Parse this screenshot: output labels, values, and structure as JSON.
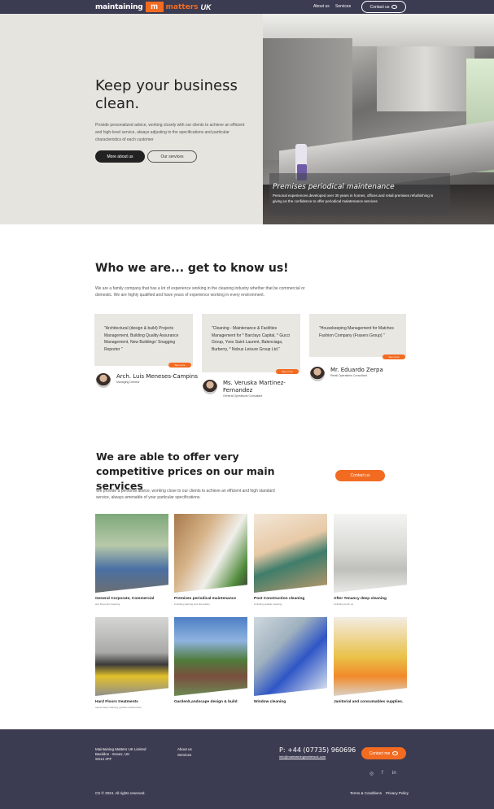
{
  "header": {
    "logo": {
      "word1": "maintaining",
      "monogram": "m",
      "word2": "matters",
      "suffix": "UK"
    },
    "nav": [
      "About us",
      "Services"
    ],
    "contact_label": "Contact us"
  },
  "hero": {
    "title": "Keep your business clean.",
    "text": "Provide personalized advice, working closely with our clients to achieve an efficient and high-level service, always adjusting to the specifications and particular characteristics of each customer",
    "btn_primary": "More about us",
    "btn_secondary": "Our services",
    "caption_title": "Premises periodical maintenance",
    "caption_text": "Personal experiences developed over 30 years in homes, offices and retail premises refurbishing is giving us the confidence to offer periodical maintenance services"
  },
  "who": {
    "title": "Who we are... get to know us!",
    "text": "We are a family company that has a lot of experience working in the cleaning industry whether that be commercial or domestic. We are highly qualified and have years of experience working in every environment.",
    "testimonials": [
      {
        "quote": "\"Architectural (design & build) Projects Management, Building Quality Assurance Management, New Buildings' Snagging Reporter \"",
        "tag": "See more",
        "name": "Arch. Luis Meneses-Campins",
        "role": "Managing Director"
      },
      {
        "quote": "\"Cleaning - Maintenance & Facilities Management for * Barclays Capital, * Gucci Group, Yves Saint Laurent, Balenciaga, Burberry, * Nobus Leisure Group Ltd.\"",
        "tag": "See more",
        "name": "Ms. Veruska Martinez-Fernandez",
        "role": "General Operations Consultant"
      },
      {
        "quote": "\"Housekeeping Management for Matches Fashion Company (Frasers Group) \"",
        "tag": "See more",
        "name": "Mr. Eduardo Zerpa",
        "role": "Retail Operations Consultant"
      }
    ]
  },
  "offer": {
    "title": "We are able to offer very competitive prices on our main services",
    "text": "We provide a personal advice, working close to our clients to achieve an efficient and high standard service, always amenable of your particular specifications.",
    "contact_label": "Contact us"
  },
  "services": [
    {
      "title": "General Corporate, Commercial",
      "sub": "and Domestic cleaning"
    },
    {
      "title": "Premises periodical maintenance",
      "sub": "including painting and decoration"
    },
    {
      "title": "Post Construction cleaning",
      "sub": "including sparkle cleaning"
    },
    {
      "title": "After Tenancy deep cleaning",
      "sub": "including touch up"
    },
    {
      "title": "Hard Floors treatments",
      "sub": "carpet deep cleaning, granite maintenance"
    },
    {
      "title": "Garden/Landscape design & build",
      "sub": ""
    },
    {
      "title": "Window cleaning",
      "sub": ""
    },
    {
      "title": "Janitorial and consumables supplies.",
      "sub": ""
    }
  ],
  "footer": {
    "address": [
      "Maintaining Matters UK Limited",
      "Basildon - Essex, UK",
      "SS14 2FF"
    ],
    "links": [
      "About us",
      "Services"
    ],
    "phone": "P: +44 (07735) 960696",
    "email": "info@maintainingmattersuk.com",
    "contact_label": "Contact me",
    "social": [
      "instagram-icon",
      "facebook-icon",
      "linkedin-icon"
    ],
    "copyright": "CS © 2024.  All rights reserved.",
    "legal": [
      "Terms & Conditions",
      "Privacy Policy"
    ]
  },
  "colors": {
    "navy": "#3b3b52",
    "orange": "#f26b21",
    "hero_bg": "#e5e4df",
    "card_bg": "#e8e7e2"
  }
}
